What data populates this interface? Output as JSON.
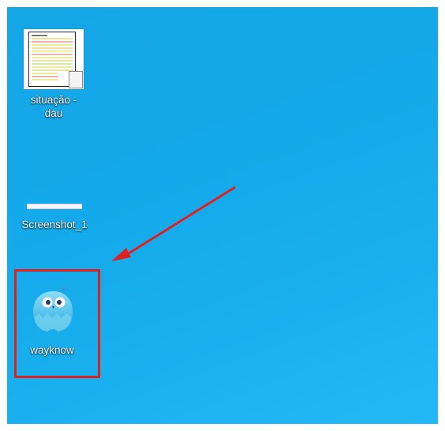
{
  "desktop": {
    "background_color": "#15a6e6",
    "icons": [
      {
        "label": "situação -\ndau",
        "icon": "spreadsheet-document-icon"
      },
      {
        "label": "Screenshot_1",
        "icon": "image-thumbnail-icon"
      },
      {
        "label": "wayknow",
        "icon": "wayknow-app-icon"
      }
    ]
  },
  "annotation": {
    "highlight_color": "#e0201f",
    "arrow_color": "#e0201f"
  }
}
